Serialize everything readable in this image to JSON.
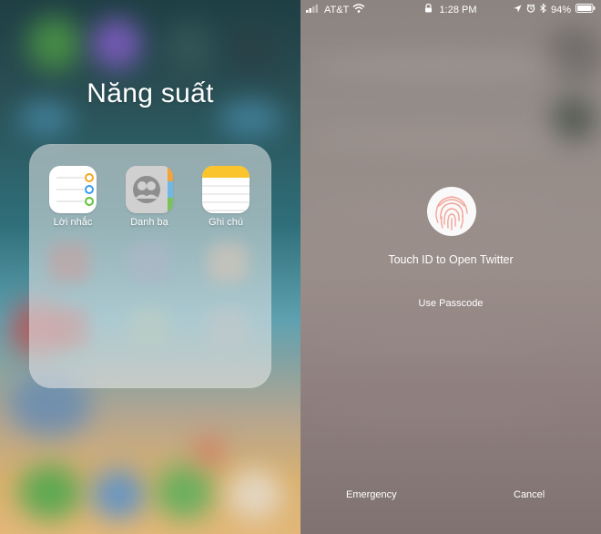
{
  "left": {
    "folder_title": "Năng suất",
    "apps": [
      {
        "label": "Lời nhắc",
        "icon": "reminders-icon"
      },
      {
        "label": "Danh bạ",
        "icon": "contacts-icon"
      },
      {
        "label": "Ghi chú",
        "icon": "notes-icon"
      }
    ]
  },
  "right": {
    "status": {
      "carrier": "AT&T",
      "time": "1:28 PM",
      "battery": "94%"
    },
    "touch_id_label": "Touch ID to Open Twitter",
    "passcode_label": "Use Passcode",
    "emergency_label": "Emergency",
    "cancel_label": "Cancel"
  },
  "colors": {
    "fingerprint": "#f2a49a",
    "notes_yellow": "#f9c42c"
  }
}
